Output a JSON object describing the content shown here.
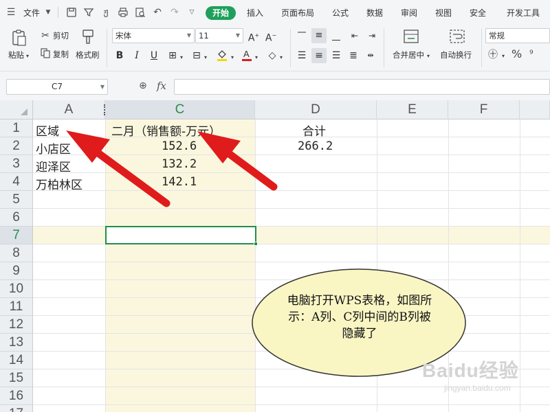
{
  "menu": {
    "file_label": "文件",
    "tabs": [
      "开始",
      "插入",
      "页面布局",
      "公式",
      "数据",
      "审阅",
      "视图",
      "安全",
      "开发工具"
    ],
    "active_tab": "开始"
  },
  "ribbon": {
    "paste": "粘贴",
    "cut": "剪切",
    "copy": "复制",
    "format_painter": "格式刷",
    "font_name": "宋体",
    "font_size": "11",
    "merge_center": "合并居中",
    "wrap_text": "自动换行",
    "number_format": "常规"
  },
  "formula_bar": {
    "cell_ref": "C7",
    "fx": "fx",
    "value": ""
  },
  "sheet": {
    "columns": [
      "A",
      "C",
      "D",
      "E",
      "F"
    ],
    "active_column": "C",
    "rows": [
      "1",
      "2",
      "3",
      "4",
      "5",
      "6",
      "7",
      "8",
      "9",
      "10",
      "11",
      "12",
      "13",
      "14",
      "15",
      "16",
      "17"
    ],
    "active_row": "7",
    "cells": {
      "A1": "区域",
      "A2": "小店区",
      "A3": "迎泽区",
      "A4": "万柏林区",
      "C1": "二月（销售额-万元）",
      "C2": "152.6",
      "C3": "132.2",
      "C4": "142.1",
      "D1": "合计",
      "D2": "266.2"
    }
  },
  "annotation": {
    "callout_text": "电脑打开WPS表格，如图所示：A列、C列中间的B列被隐藏了",
    "arrow_color": "#e01b1b",
    "callout_fill": "#f9f6c4"
  },
  "watermark": {
    "logo": "Baidu经验",
    "url": "jingyan.baidu.com"
  },
  "colors": {
    "accent_green": "#1ea05a",
    "selection_band": "#fbf7de",
    "active_border": "#1e8f4a"
  }
}
